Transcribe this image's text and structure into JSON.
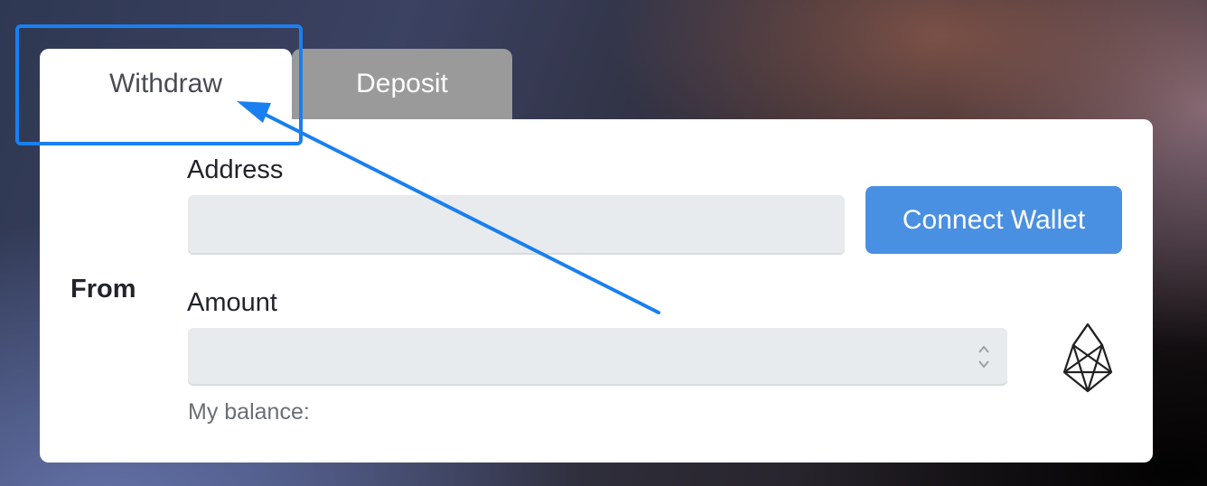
{
  "tabs": [
    {
      "label": "Withdraw",
      "active": true
    },
    {
      "label": "Deposit",
      "active": false
    }
  ],
  "form": {
    "section_label": "From",
    "address": {
      "label": "Address",
      "value": "",
      "placeholder": ""
    },
    "connect_button": "Connect Wallet",
    "amount": {
      "label": "Amount",
      "value": "",
      "placeholder": ""
    },
    "balance_label": "My balance:",
    "token_icon": "eos-icon"
  },
  "annotation": {
    "color": "#1a7ff0",
    "target": "Withdraw tab"
  },
  "colors": {
    "accent": "#4a90e2",
    "inactive_tab": "#9a9a9a",
    "field_bg": "#e8ebee"
  }
}
